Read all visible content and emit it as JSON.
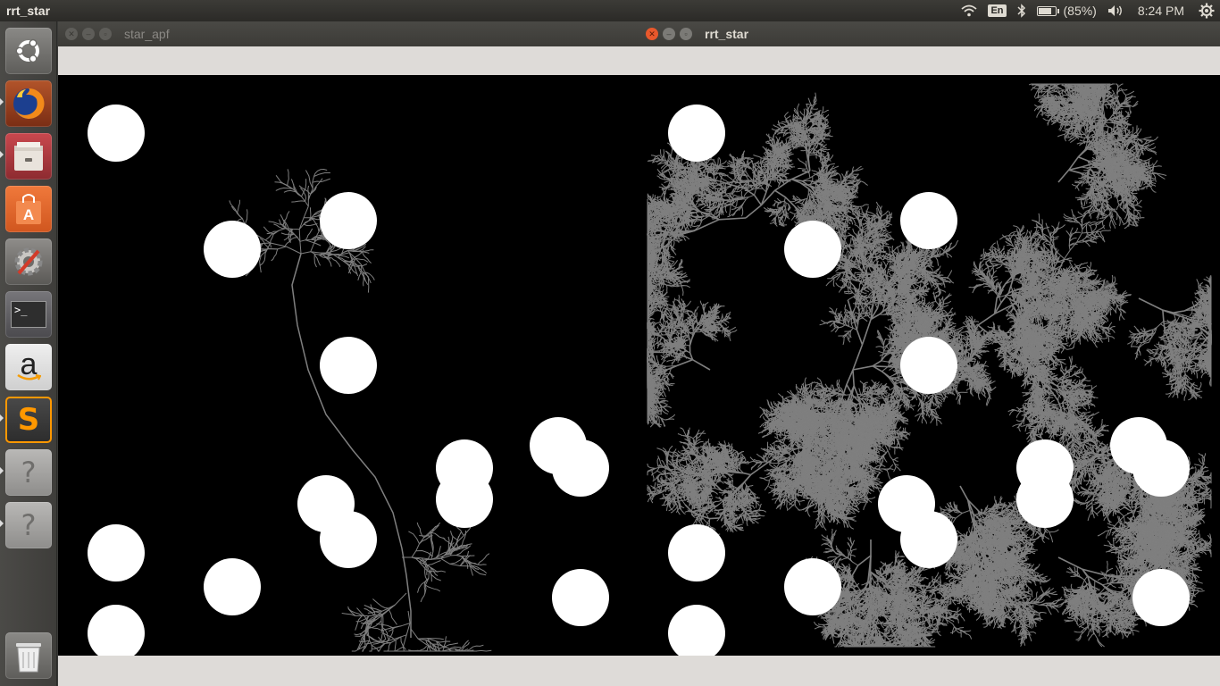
{
  "top_panel": {
    "app_title": "rrt_star",
    "language": "En",
    "battery": "(85%)",
    "battery_level": 0.85,
    "time": "8:24 PM",
    "icons": [
      "wifi-icon",
      "bluetooth-icon",
      "battery-icon",
      "volume-icon",
      "settings-gear-icon"
    ]
  },
  "launcher": {
    "items": [
      {
        "name": "ubuntu-dash",
        "icon": "ubuntu-logo-icon"
      },
      {
        "name": "firefox",
        "icon": "firefox-icon"
      },
      {
        "name": "files",
        "icon": "file-cabinet-icon"
      },
      {
        "name": "software-center",
        "icon": "shopping-bag-icon"
      },
      {
        "name": "system-settings",
        "icon": "wrench-gear-icon"
      },
      {
        "name": "terminal",
        "icon": "terminal-icon",
        "glyph": ">_"
      },
      {
        "name": "amazon",
        "icon": "amazon-icon",
        "glyph": "a"
      },
      {
        "name": "sublime-text",
        "icon": "sublime-icon",
        "glyph": "S"
      },
      {
        "name": "unknown-app-1",
        "icon": "question-icon",
        "glyph": "?"
      },
      {
        "name": "unknown-app-2",
        "icon": "question-icon",
        "glyph": "?"
      },
      {
        "name": "trash",
        "icon": "trash-icon"
      }
    ]
  },
  "windows": {
    "left": {
      "title": "star_apf",
      "active": false
    },
    "right": {
      "title": "rrt_star",
      "active": true
    }
  },
  "colors": {
    "canvas_bg": "#000000",
    "obstacle": "#ffffff",
    "tree": "#7f7f7f",
    "close_active": "#e8582c",
    "window_chrome": "#dedbd8"
  }
}
